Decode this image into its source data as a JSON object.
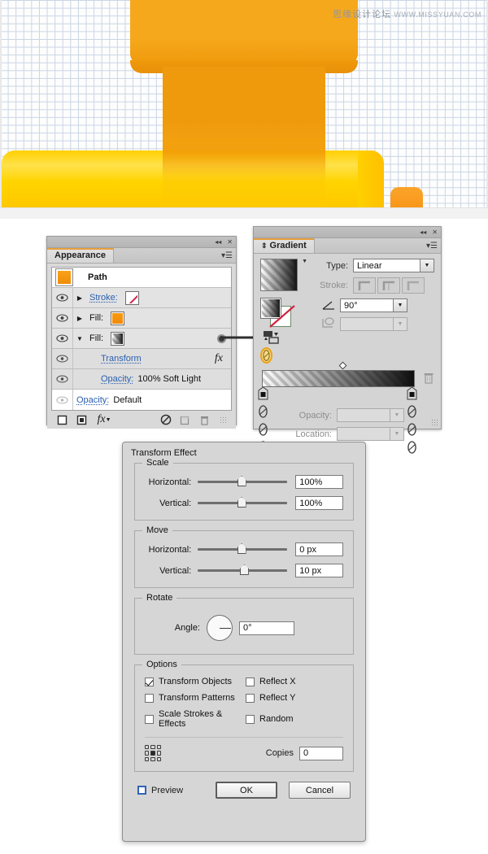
{
  "canvas": {
    "watermark_cn": "思缘设计论坛",
    "watermark_url": "WWW.MISSYUAN.COM",
    "artwork_name": "orange-ribbon-banner",
    "colors": {
      "ribbon_light": "#ffd400",
      "ribbon_mid": "#f6a81c",
      "ribbon_dark": "#ef9a0d",
      "grid_line": "#c9d4e4"
    }
  },
  "appearance_panel": {
    "tab_label": "Appearance",
    "titlebar": {
      "collapse_icon": "◂◂",
      "close_icon": "✕",
      "menu_icon": "▾☰"
    },
    "target_label": "Path",
    "rows": [
      {
        "label": "Stroke:",
        "value": "",
        "swatch": "none",
        "visible": true,
        "expanded": false
      },
      {
        "label": "Fill:",
        "value": "",
        "swatch": "orange",
        "visible": true,
        "expanded": false
      },
      {
        "label": "Fill:",
        "value": "",
        "swatch": "gradient",
        "visible": true,
        "expanded": true
      },
      {
        "label": "Transform",
        "value": "",
        "swatch": "",
        "visible": true,
        "fx": "fx"
      },
      {
        "label": "Opacity:",
        "value": "100% Soft Light",
        "swatch": "",
        "visible": true
      },
      {
        "label": "Opacity:",
        "value": "Default",
        "swatch": "",
        "visible": false
      }
    ],
    "footer_buttons": [
      "add-new-stroke",
      "add-new-fill",
      "add-new-effect",
      "clear-appearance",
      "duplicate-item",
      "delete-item"
    ],
    "footer_fx_label": "fx"
  },
  "gradient_panel": {
    "tab_label": "Gradient",
    "titlebar": {
      "collapse_icon": "◂◂",
      "close_icon": "✕",
      "menu_icon": "▾☰"
    },
    "type_label": "Type:",
    "type_value": "Linear",
    "stroke_label": "Stroke:",
    "angle_label": "angle",
    "angle_value": "90°",
    "aspect_value": "",
    "opacity_label": "Opacity:",
    "opacity_value": "",
    "location_label": "Location:",
    "location_value": "",
    "gradient_stops": [
      {
        "position": 0,
        "color": "transparent"
      },
      {
        "position": 100,
        "color": "#000000"
      }
    ],
    "midpoint": 50
  },
  "transform_dialog": {
    "title": "Transform Effect",
    "scale": {
      "legend": "Scale",
      "horizontal_label": "Horizontal:",
      "horizontal_value": "100%",
      "vertical_label": "Vertical:",
      "vertical_value": "100%"
    },
    "move": {
      "legend": "Move",
      "horizontal_label": "Horizontal:",
      "horizontal_value": "0 px",
      "vertical_label": "Vertical:",
      "vertical_value": "10 px"
    },
    "rotate": {
      "legend": "Rotate",
      "angle_label": "Angle:",
      "angle_value": "0°"
    },
    "options": {
      "legend": "Options",
      "items": [
        {
          "label": "Transform Objects",
          "checked": true
        },
        {
          "label": "Reflect X",
          "checked": false
        },
        {
          "label": "Transform Patterns",
          "checked": false
        },
        {
          "label": "Reflect Y",
          "checked": false
        },
        {
          "label": "Scale Strokes & Effects",
          "checked": false
        },
        {
          "label": "Random",
          "checked": false
        }
      ],
      "copies_label": "Copies",
      "copies_value": "0"
    },
    "preview_label": "Preview",
    "preview_checked": false,
    "ok_label": "OK",
    "cancel_label": "Cancel"
  }
}
